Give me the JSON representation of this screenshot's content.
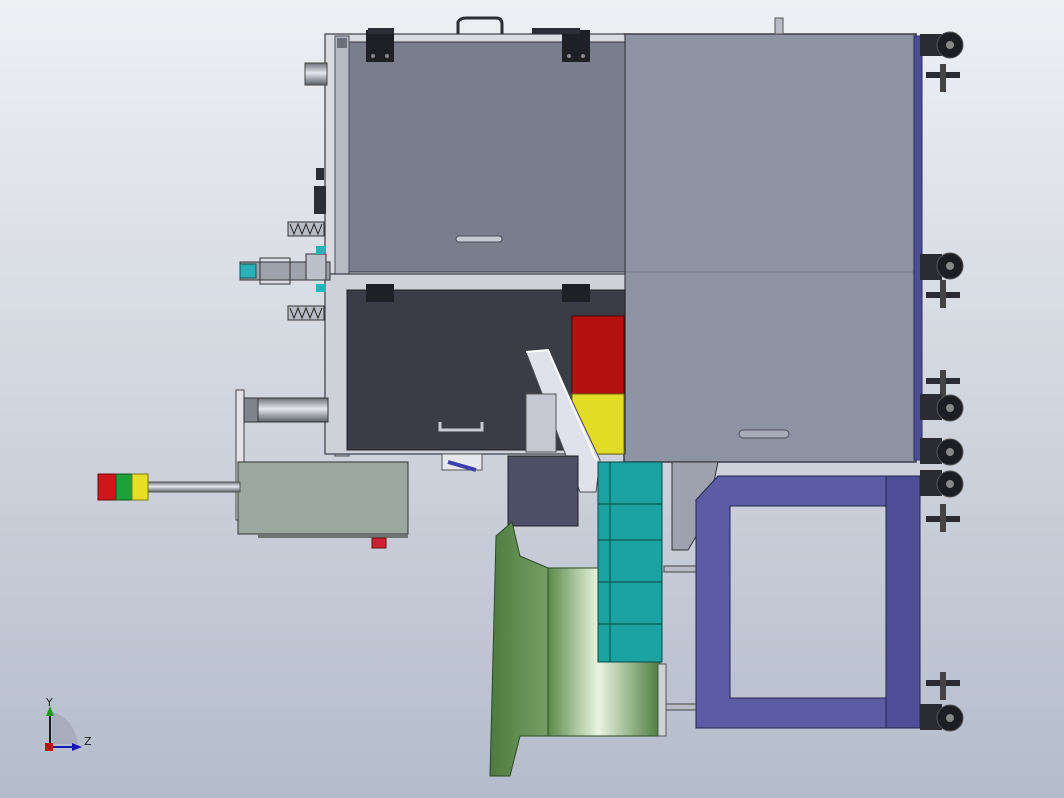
{
  "view": {
    "triad_labels": {
      "y": "Y",
      "z": "Z"
    }
  },
  "colors": {
    "background_top": "#eef0f4",
    "background_bottom": "#b4bccb",
    "cabinet_upper": "#7a7e8c",
    "cabinet_lower": "#3b3c45",
    "side_panel": "#8e93a3",
    "frame_blue": "#5b5ca3",
    "teal": "#1aa3a0",
    "green_cone": "#6fa35c",
    "red_part": "#b50f0f",
    "yellow_part": "#e2dc27",
    "signal_red": "#d0161b",
    "signal_green": "#1aa33a",
    "signal_yellow": "#e8e026"
  }
}
